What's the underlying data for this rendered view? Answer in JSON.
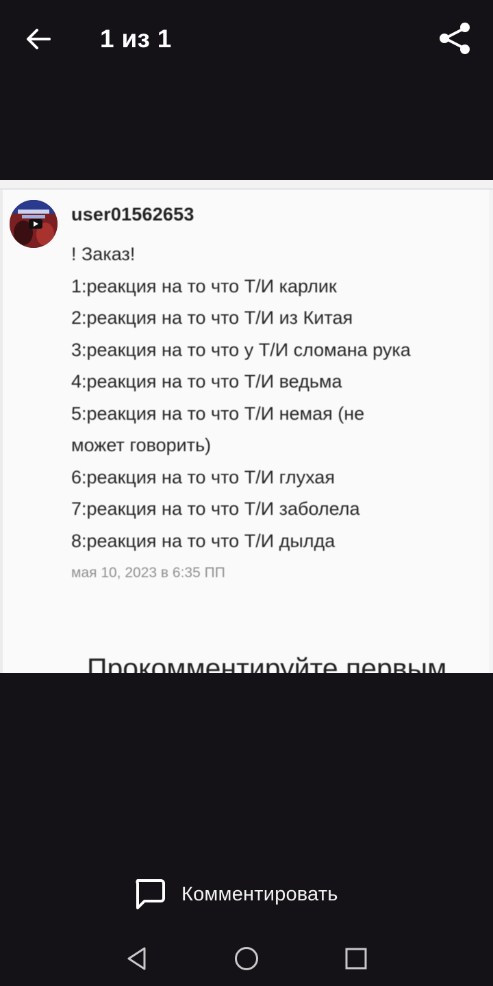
{
  "topbar": {
    "title": "1 из 1",
    "back_icon": "arrow-left-icon",
    "share_icon": "share-icon"
  },
  "post": {
    "username": "user01562653",
    "lines": [
      "! Заказ!",
      "1:реакция на то что Т/И карлик",
      "2:реакция на то что Т/И из Китая",
      "3:реакция на то что у Т/И сломана рука",
      "4:реакция на то что Т/И ведьма",
      "5:реакция на то что Т/И немая (не",
      "может говорить)",
      "6:реакция на то что Т/И глухая",
      "7:реакция на то что Т/И заболела",
      "8:реакция на то что Т/И дылда"
    ],
    "timestamp": "мая 10, 2023 в 6:35 ПП",
    "comment_prompt": "Прокомментируйте первым"
  },
  "comment_bar": {
    "label": "Комментировать",
    "icon": "comment-icon"
  },
  "colors": {
    "background": "#141217",
    "image_background": "#fafafa",
    "text_light": "#ffffff"
  }
}
